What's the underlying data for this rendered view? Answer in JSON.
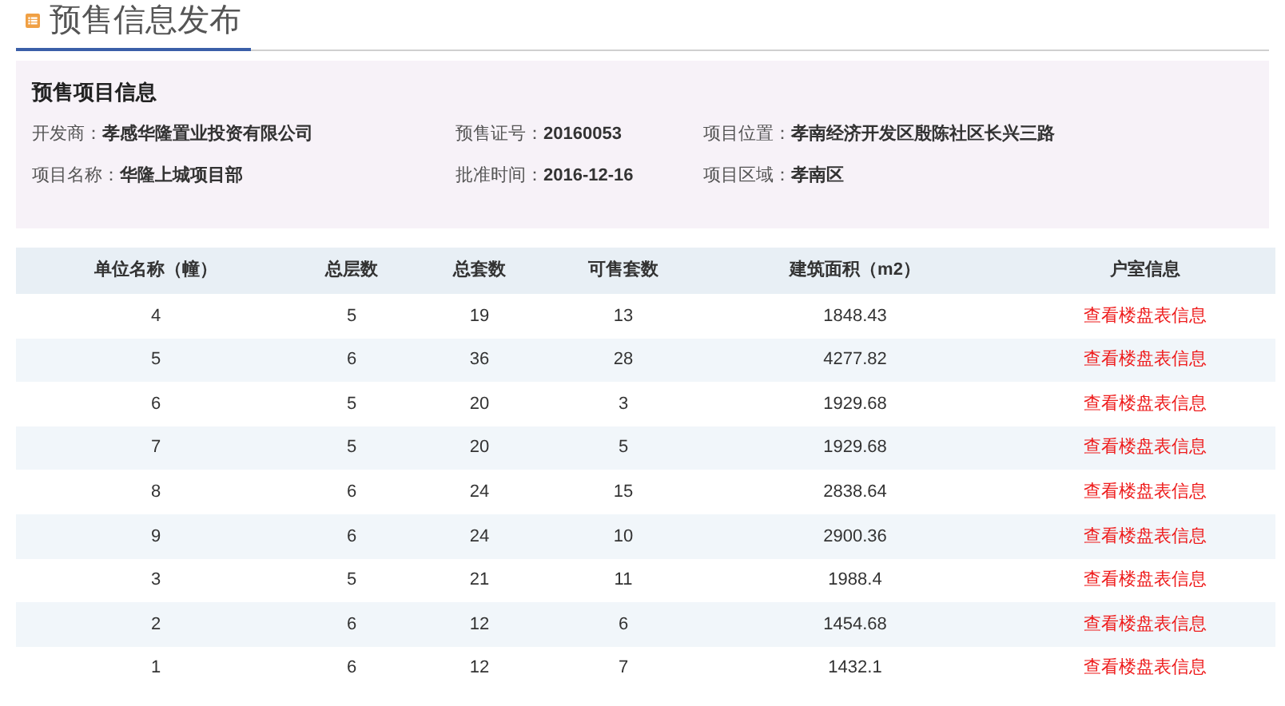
{
  "page_title": "预售信息发布",
  "project_info": {
    "title": "预售项目信息",
    "fields": [
      {
        "label": "开发商：",
        "value": "孝感华隆置业投资有限公司"
      },
      {
        "label": "预售证号：",
        "value": "20160053"
      },
      {
        "label": "项目位置：",
        "value": "孝南经济开发区殷陈社区长兴三路"
      },
      {
        "label": "项目名称：",
        "value": "华隆上城项目部"
      },
      {
        "label": "批准时间：",
        "value": "2016-12-16"
      },
      {
        "label": "项目区域：",
        "value": "孝南区"
      }
    ]
  },
  "table": {
    "columns": [
      "单位名称（幢）",
      "总层数",
      "总套数",
      "可售套数",
      "建筑面积（m2）",
      "户室信息"
    ],
    "rows": [
      [
        "4",
        "5",
        "19",
        "13",
        "1848.43",
        "查看楼盘表信息"
      ],
      [
        "5",
        "6",
        "36",
        "28",
        "4277.82",
        "查看楼盘表信息"
      ],
      [
        "6",
        "5",
        "20",
        "3",
        "1929.68",
        "查看楼盘表信息"
      ],
      [
        "7",
        "5",
        "20",
        "5",
        "1929.68",
        "查看楼盘表信息"
      ],
      [
        "8",
        "6",
        "24",
        "15",
        "2838.64",
        "查看楼盘表信息"
      ],
      [
        "9",
        "6",
        "24",
        "10",
        "2900.36",
        "查看楼盘表信息"
      ],
      [
        "3",
        "5",
        "21",
        "11",
        "1988.4",
        "查看楼盘表信息"
      ],
      [
        "2",
        "6",
        "12",
        "6",
        "1454.68",
        "查看楼盘表信息"
      ],
      [
        "1",
        "6",
        "12",
        "7",
        "1432.1",
        "查看楼盘表信息"
      ]
    ]
  }
}
